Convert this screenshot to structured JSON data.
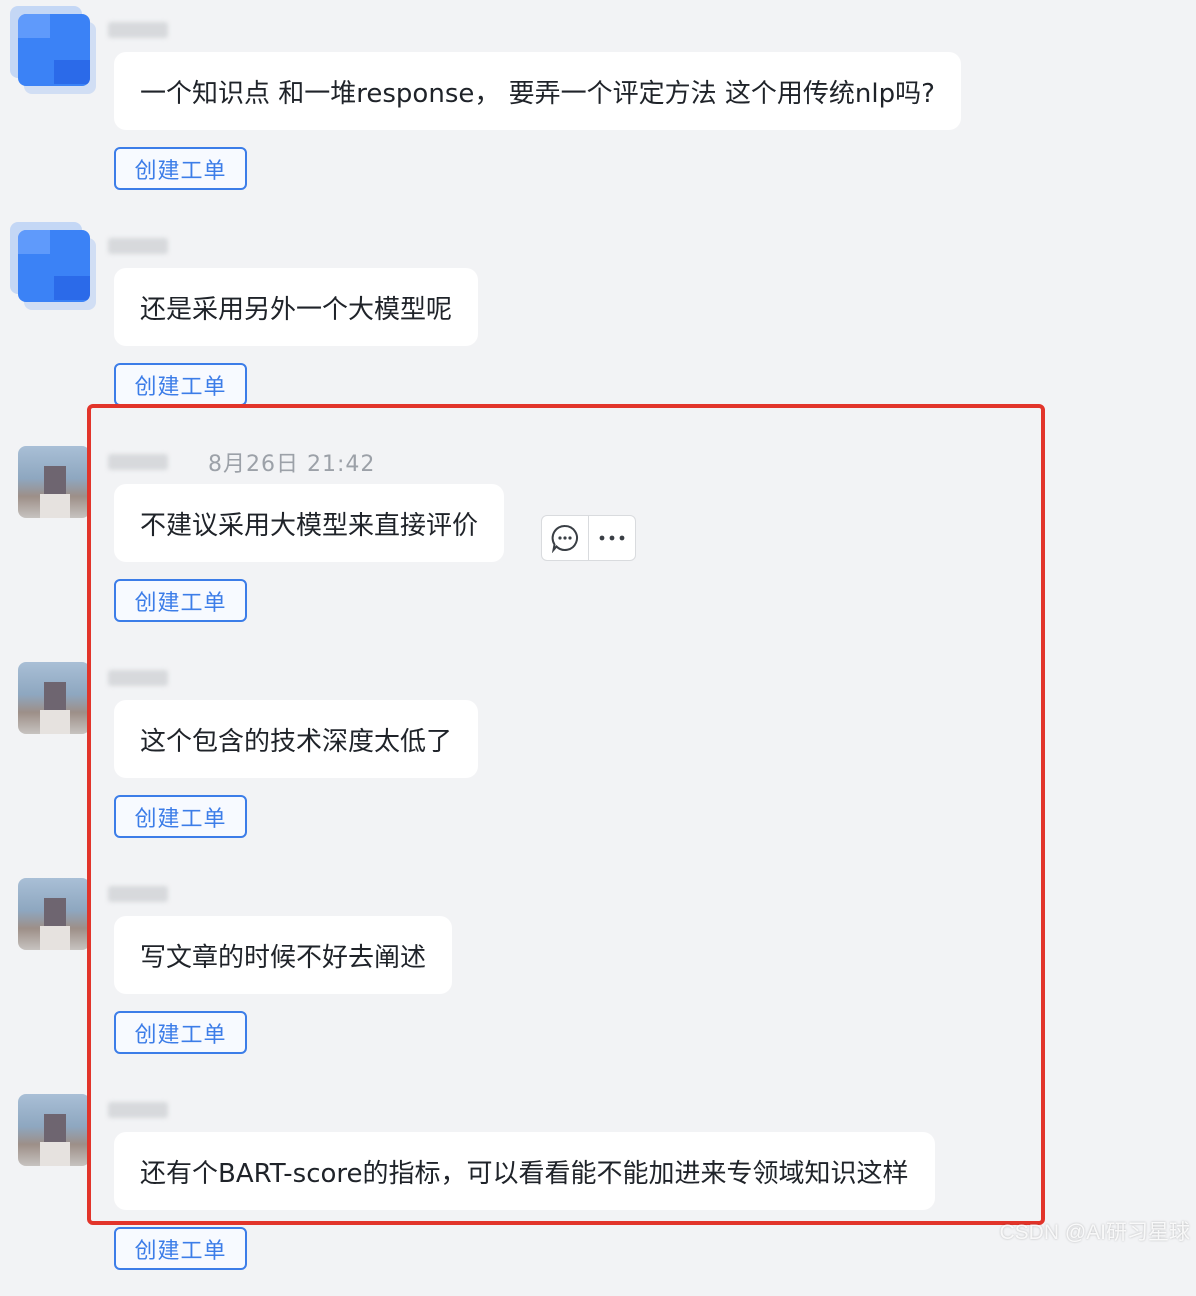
{
  "messages": [
    {
      "text": "一个知识点 和一堆response， 要弄一个评定方法  这个用传统nlp吗?",
      "avatar": "blue-blurred-avatar",
      "create_ticket_label": "创建工单"
    },
    {
      "text": "还是采用另外一个大模型呢",
      "avatar": "blue-blurred-avatar",
      "create_ticket_label": "创建工单"
    },
    {
      "text": "不建议采用大模型来直接评价",
      "avatar": "blurred-photo-avatar",
      "timestamp": "8月26日 21:42",
      "create_ticket_label": "创建工单"
    },
    {
      "text": "这个包含的技术深度太低了",
      "avatar": "blurred-photo-avatar",
      "create_ticket_label": "创建工单"
    },
    {
      "text": "写文章的时候不好去阐述",
      "avatar": "blurred-photo-avatar",
      "create_ticket_label": "创建工单"
    },
    {
      "text": "还有个BART-score的指标，可以看看能不能加进来专领域知识这样",
      "avatar": "blurred-photo-avatar",
      "create_ticket_label": "创建工单"
    }
  ],
  "hover_actions": [
    "reply-icon",
    "more-icon"
  ],
  "highlight_color": "#e2342a",
  "accent_color": "#3c7de8",
  "watermark": "CSDN @AI研习星球"
}
